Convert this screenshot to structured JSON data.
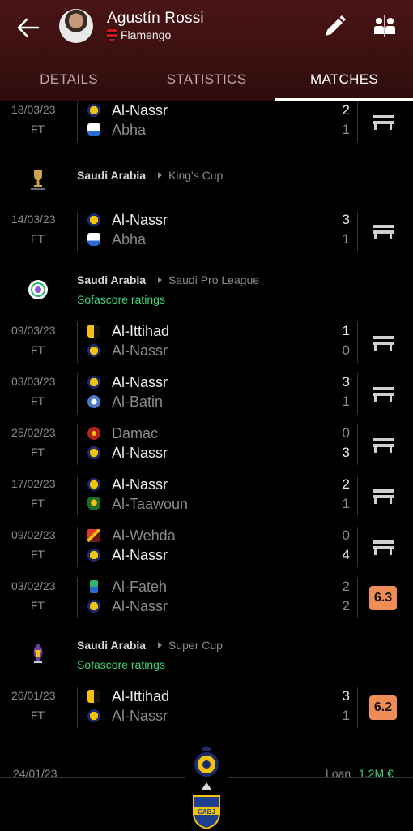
{
  "header": {
    "player_name": "Agustín Rossi",
    "team_name": "Flamengo",
    "icons": {
      "back": "back-arrow-icon",
      "edit": "pencil-icon",
      "compare": "compare-players-icon"
    }
  },
  "tabs": [
    {
      "label": "DETAILS",
      "active": false
    },
    {
      "label": "STATISTICS",
      "active": false
    },
    {
      "label": "MATCHES",
      "active": true
    }
  ],
  "colors": {
    "header_bg": "#4a1414",
    "rating_orange": "#f08c55",
    "green_accent": "#3fd47a",
    "muted_text": "#8a8a8a"
  },
  "leagues": [
    {
      "country": "Saudi Arabia",
      "name": "King's Cup",
      "ratings_label": ""
    },
    {
      "country": "Saudi Arabia",
      "name": "Saudi Pro League",
      "ratings_label": "Sofascore ratings"
    },
    {
      "country": "Saudi Arabia",
      "name": "Super Cup",
      "ratings_label": "Sofascore ratings"
    }
  ],
  "matches": [
    {
      "date": "18/03/23",
      "status": "FT",
      "home": "Al-Nassr",
      "away": "Abha",
      "home_score": "2",
      "away_score": "1",
      "winner": "home",
      "rating": ""
    },
    {
      "date": "14/03/23",
      "status": "FT",
      "home": "Al-Nassr",
      "away": "Abha",
      "home_score": "3",
      "away_score": "1",
      "winner": "home",
      "rating": ""
    },
    {
      "date": "09/03/23",
      "status": "FT",
      "home": "Al-Ittihad",
      "away": "Al-Nassr",
      "home_score": "1",
      "away_score": "0",
      "winner": "home",
      "rating": ""
    },
    {
      "date": "03/03/23",
      "status": "FT",
      "home": "Al-Nassr",
      "away": "Al-Batin",
      "home_score": "3",
      "away_score": "1",
      "winner": "home",
      "rating": ""
    },
    {
      "date": "25/02/23",
      "status": "FT",
      "home": "Damac",
      "away": "Al-Nassr",
      "home_score": "0",
      "away_score": "3",
      "winner": "away",
      "rating": ""
    },
    {
      "date": "17/02/23",
      "status": "FT",
      "home": "Al-Nassr",
      "away": "Al-Taawoun",
      "home_score": "2",
      "away_score": "1",
      "winner": "home",
      "rating": ""
    },
    {
      "date": "09/02/23",
      "status": "FT",
      "home": "Al-Wehda",
      "away": "Al-Nassr",
      "home_score": "0",
      "away_score": "4",
      "winner": "away",
      "rating": ""
    },
    {
      "date": "03/02/23",
      "status": "FT",
      "home": "Al-Fateh",
      "away": "Al-Nassr",
      "home_score": "2",
      "away_score": "2",
      "winner": "none",
      "rating": "6.3"
    },
    {
      "date": "26/01/23",
      "status": "FT",
      "home": "Al-Ittihad",
      "away": "Al-Nassr",
      "home_score": "3",
      "away_score": "1",
      "winner": "home",
      "rating": "6.2"
    }
  ],
  "transfer": {
    "date": "24/01/23",
    "type": "Loan",
    "fee": "1.2M €"
  }
}
